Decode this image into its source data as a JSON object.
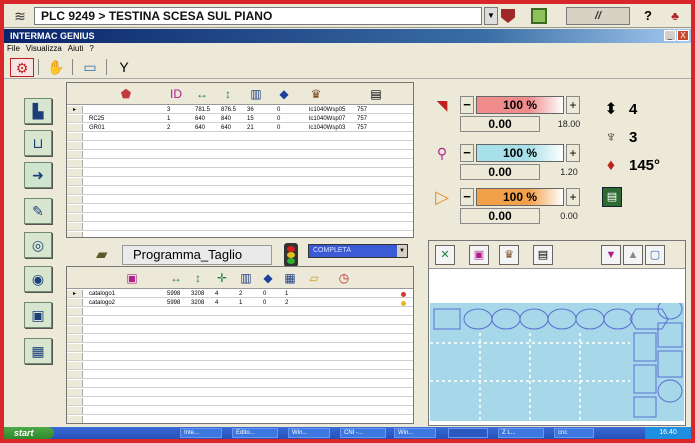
{
  "plc": {
    "message": "PLC 9249 > TESTINA SCESA SUL PIANO",
    "help_label": "?"
  },
  "window": {
    "title": "INTERMAC GENIUS",
    "min": "_",
    "close": "X"
  },
  "menu": [
    "File",
    "Visualizza",
    "Aiuti",
    "?"
  ],
  "tools_table": {
    "rows": [
      {
        "name": "",
        "c1": "3",
        "c2": "781.5",
        "c3": "876.5",
        "c4": "36",
        "c5": "0",
        "c6": "lc1040Wsp05",
        "c7": "757"
      },
      {
        "name": "RC25",
        "c1": "1",
        "c2": "640",
        "c3": "840",
        "c4": "15",
        "c5": "0",
        "c6": "lc1040Wsp07",
        "c7": "757"
      },
      {
        "name": "GR01",
        "c1": "2",
        "c2": "640",
        "c3": "640",
        "c4": "21",
        "c5": "0",
        "c6": "lc1040Wsp03",
        "c7": "757"
      }
    ]
  },
  "program": {
    "name": "Programma_Taglio",
    "mode": "COMPLETA"
  },
  "catalog_table": {
    "rows": [
      {
        "name": "catalogo1",
        "c1": "5998",
        "c2": "3208",
        "c3": "4",
        "c4": "2",
        "c5": "0",
        "c6": "1",
        "dot": "#d83a2a"
      },
      {
        "name": "catalogo2",
        "c1": "5998",
        "c2": "3208",
        "c3": "4",
        "c4": "1",
        "c5": "0",
        "c6": "2",
        "dot": "#e8b520"
      }
    ]
  },
  "controls": [
    {
      "percent": "100 %",
      "actual": "0.00",
      "max": "18.00",
      "color": "#f08c8c"
    },
    {
      "percent": "100 %",
      "actual": "0.00",
      "max": "1.20",
      "color": "#a8e0ea"
    },
    {
      "percent": "100 %",
      "actual": "0.00",
      "max": "0.00",
      "color": "#f3a04a"
    }
  ],
  "stats": {
    "heads": "4",
    "tools": "3",
    "angle": "145°"
  },
  "taskbar": {
    "start": "start",
    "tasks": [
      "Inte...",
      "Edito...",
      "Win...",
      "CNI -...",
      "Win...",
      "",
      "Z L...",
      "cnc"
    ],
    "clock": "16.40"
  }
}
